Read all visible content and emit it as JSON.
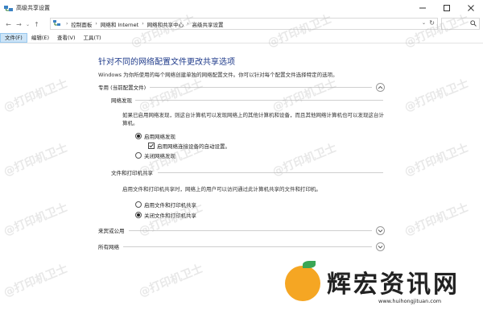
{
  "window": {
    "title": "高级共享设置",
    "controls": [
      "minimize-icon",
      "maximize-icon",
      "close-icon"
    ]
  },
  "nav": {
    "back": "←",
    "forward": "→",
    "recent": "⌄",
    "up": "↑"
  },
  "address": {
    "crumbs": [
      "控制面板",
      "网络和 Internet",
      "网络和共享中心",
      "高级共享设置"
    ],
    "separator": "›"
  },
  "menubar": {
    "items": [
      "文件(F)",
      "编辑(E)",
      "查看(V)",
      "工具(T)"
    ]
  },
  "main": {
    "heading": "针对不同的网络配置文件更改共享选项",
    "description": "Windows 为你所使用的每个网络创建单独的网络配置文件。你可以针对每个配置文件选择特定的选项。",
    "profiles": {
      "private": {
        "label": "专用 (当前配置文件)",
        "network_discovery": {
          "title": "网络发现",
          "description": "如果已启用网络发现，则这台计算机可以发现网络上的其他计算机和设备，而且其他网络计算机也可以发现这台计算机。",
          "options": [
            {
              "label": "启用网络发现",
              "selected": true
            },
            {
              "label": "关闭网络发现",
              "selected": false
            }
          ],
          "auto_setup": {
            "label": "启用网络连接设备的自动设置。",
            "checked": true
          }
        },
        "file_printer_sharing": {
          "title": "文件和打印机共享",
          "description": "启用文件和打印机共享时，网络上的用户可以访问通过此计算机共享的文件和打印机。",
          "options": [
            {
              "label": "启用文件和打印机共享",
              "selected": false
            },
            {
              "label": "关闭文件和打印机共享",
              "selected": true
            }
          ]
        }
      },
      "guest_public": {
        "label": "来宾或公用"
      },
      "all_networks": {
        "label": "所有网络"
      }
    }
  },
  "watermark": {
    "text": "@打印机卫士"
  },
  "logo": {
    "text": "辉宏资讯网",
    "url": "www.huihongjituan.com"
  },
  "colors": {
    "heading": "#1e3a8a",
    "menu_active_bg": "#cce4f7",
    "logo_orange": "#f5a623",
    "logo_leaf": "#3aa655"
  }
}
